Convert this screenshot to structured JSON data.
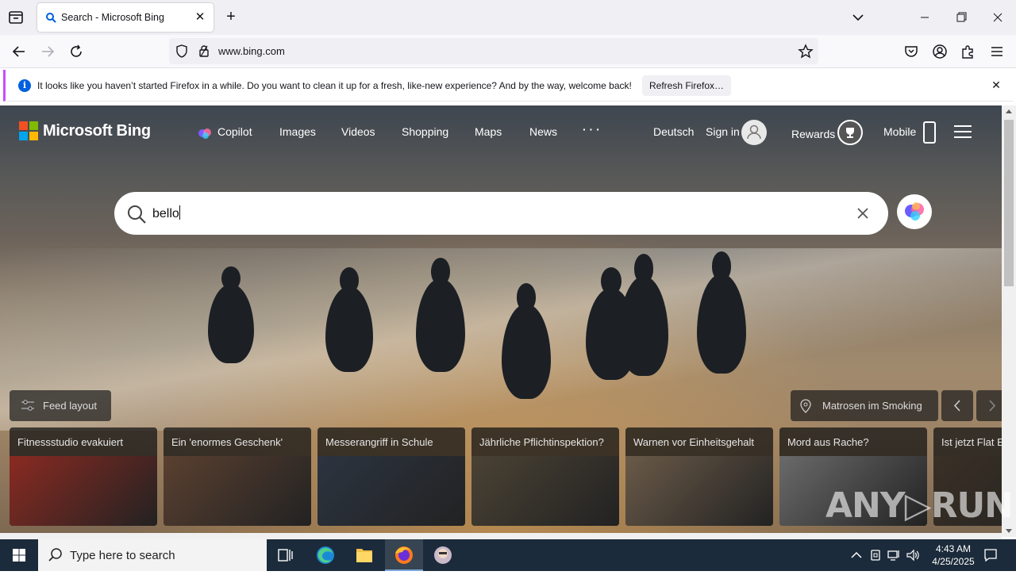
{
  "browser": {
    "tab": {
      "title": "Search - Microsoft Bing",
      "close": "✕"
    },
    "new_tab": "+",
    "url": "www.bing.com",
    "notification": {
      "icon": "i",
      "text": "It looks like you haven’t started Firefox in a while. Do you want to clean it up for a fresh, like-new experience? And by the way, welcome back!",
      "button": "Refresh Firefox…",
      "close": "✕"
    }
  },
  "bing": {
    "logo_text": "Microsoft Bing",
    "nav": [
      "Copilot",
      "Images",
      "Videos",
      "Shopping",
      "Maps",
      "News",
      "· · ·"
    ],
    "language": "Deutsch",
    "sign_in": "Sign in",
    "rewards": "Rewards",
    "mobile": "Mobile",
    "search": {
      "value": "bello"
    },
    "feed_layout": "Feed layout",
    "location_label": "Matrosen im Smoking",
    "cards": [
      {
        "title": "Fitnessstudio evakuiert",
        "color": "#8a2a22"
      },
      {
        "title": "Ein 'enormes Geschenk'",
        "color": "#5a4030"
      },
      {
        "title": "Messerangriff in Schule",
        "color": "#2c3440"
      },
      {
        "title": "Jährliche Pflichtinspektion?",
        "color": "#4a4234"
      },
      {
        "title": "Warnen vor Einheitsgehalt",
        "color": "#6a5a48"
      },
      {
        "title": "Mord aus Rache?",
        "color": "#6a6a6a"
      },
      {
        "title": "Ist jetzt Flat E",
        "color": "#3a3026"
      }
    ],
    "watermark": "ANY▷RUN"
  },
  "taskbar": {
    "search_placeholder": "Type here to search",
    "time": "4:43 AM",
    "date": "4/25/2025"
  },
  "colors": {
    "ms_red": "#f25022",
    "ms_green": "#7fba00",
    "ms_blue": "#00a4ef",
    "ms_yellow": "#ffb900",
    "accent_purple": "#c94cff",
    "firefox_blue": "#0060df"
  }
}
